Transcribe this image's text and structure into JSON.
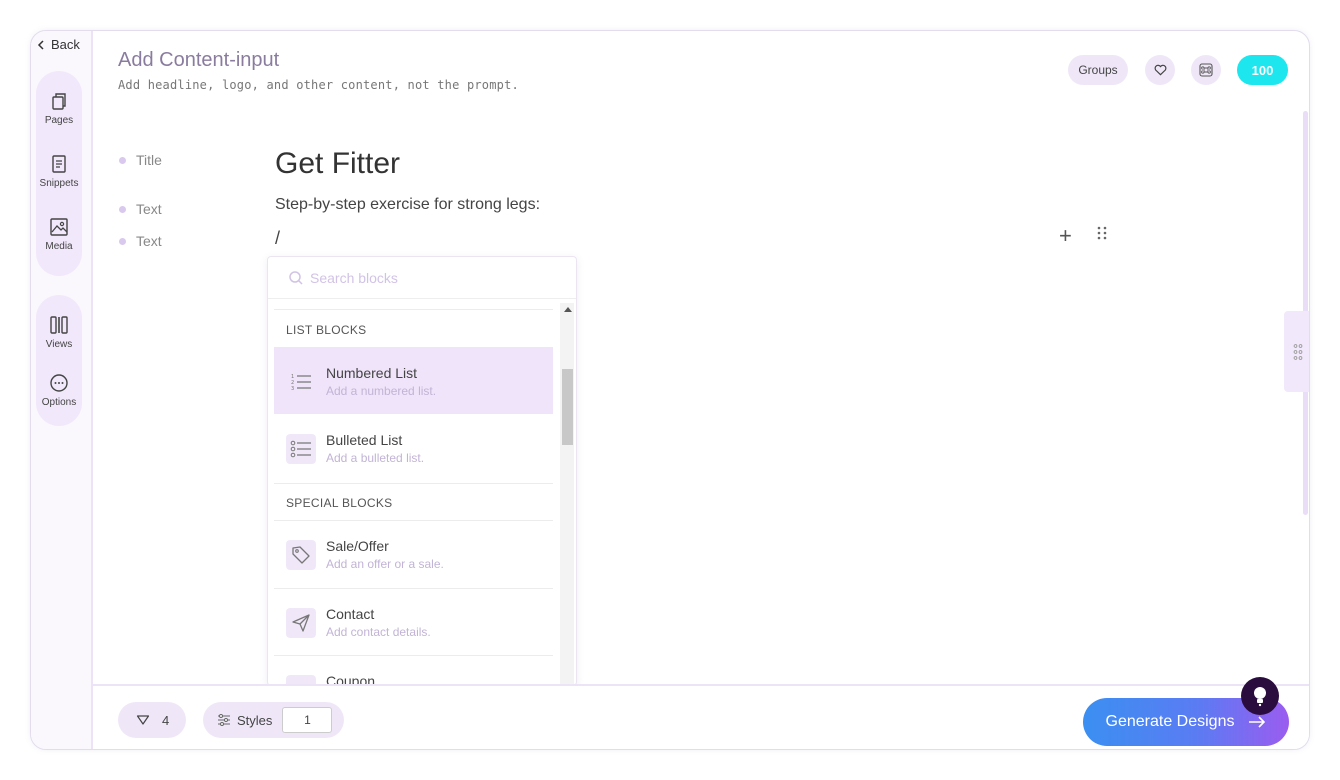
{
  "nav": {
    "back_label": "Back"
  },
  "rail": {
    "pages": "Pages",
    "snippets": "Snippets",
    "media": "Media",
    "views": "Views",
    "options": "Options"
  },
  "header": {
    "title": "Add Content-input",
    "subtitle": "Add headline, logo, and other content, not the prompt.",
    "groups_label": "Groups",
    "credits": "100"
  },
  "content": {
    "labels": [
      "Title",
      "Text",
      "Text"
    ],
    "title": "Get Fitter",
    "text": "Step-by-step exercise for strong legs:",
    "input": "/"
  },
  "dropdown": {
    "search_placeholder": "Search blocks",
    "sections": [
      {
        "title": "LIST BLOCKS",
        "items": [
          {
            "title": "Numbered List",
            "desc": "Add a numbered list.",
            "icon": "numbered-list-icon"
          },
          {
            "title": "Bulleted List",
            "desc": "Add a bulleted list.",
            "icon": "bulleted-list-icon"
          }
        ]
      },
      {
        "title": "SPECIAL BLOCKS",
        "items": [
          {
            "title": "Sale/Offer",
            "desc": "Add an offer or a sale.",
            "icon": "tag-icon"
          },
          {
            "title": "Contact",
            "desc": "Add contact details.",
            "icon": "send-icon"
          },
          {
            "title": "Coupon",
            "desc": "",
            "icon": "coupon-icon"
          }
        ]
      }
    ]
  },
  "footer": {
    "likes": "4",
    "styles_label": "Styles",
    "styles_value": "1",
    "generate_label": "Generate Designs"
  },
  "colors": {
    "accent": "#8a63d2",
    "credits": "#1de6ee",
    "generate_start": "#3b8ff2",
    "generate_end": "#9b5cf0",
    "active_item": "#efe4f9"
  }
}
